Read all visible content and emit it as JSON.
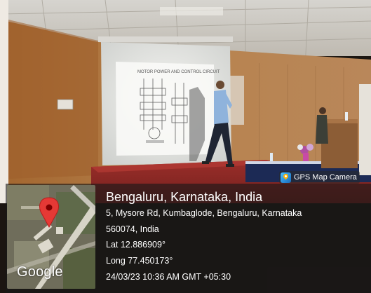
{
  "badge": {
    "label": "GPS Map Camera",
    "icon": "gps-map-camera-icon"
  },
  "map": {
    "provider_mark": "Google",
    "pin_icon": "location-pin-icon",
    "pin_color": "#e53935"
  },
  "location": {
    "title": "Bengaluru, Karnataka, India",
    "address_line1": "5, Mysore Rd, Kumbaglode, Bengaluru, Karnataka",
    "address_line2": "560074, India",
    "latitude": "Lat 12.886909°",
    "longitude": "Long 77.450173°",
    "datetime": "24/03/23 10:36 AM GMT +05:30"
  },
  "slide": {
    "heading": "MOTOR POWER AND CONTROL CIRCUIT"
  }
}
